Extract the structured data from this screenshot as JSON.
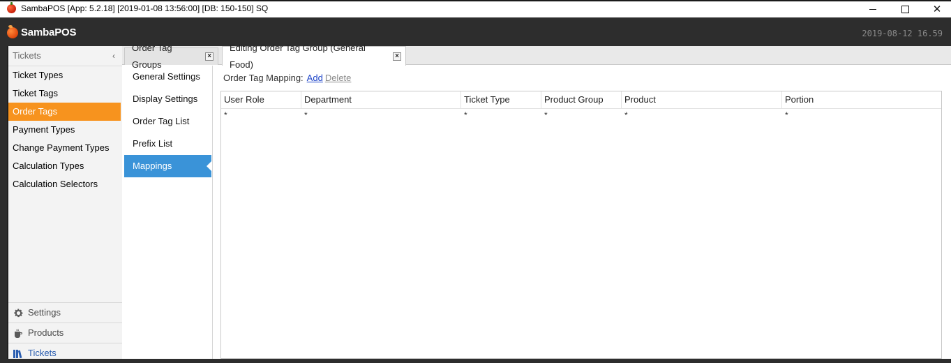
{
  "window": {
    "title": "SambaPOS [App: 5.2.18] [2019-01-08 13:56:00] [DB: 150-150] SQ",
    "close_glyph": "✕"
  },
  "header": {
    "brand": "SambaPOS",
    "clock": "2019-08-12 16.59"
  },
  "leftnav": {
    "section": "Tickets",
    "collapse_glyph": "‹",
    "items": [
      {
        "label": "Ticket Types"
      },
      {
        "label": "Ticket Tags"
      },
      {
        "label": "Order Tags",
        "active": true
      },
      {
        "label": "Payment Types"
      },
      {
        "label": "Change Payment Types"
      },
      {
        "label": "Calculation Types"
      },
      {
        "label": "Calculation Selectors"
      }
    ],
    "bottom": [
      {
        "label": "Settings",
        "icon": "gear-icon"
      },
      {
        "label": "Products",
        "icon": "cup-icon"
      },
      {
        "label": "Tickets",
        "icon": "books-icon"
      }
    ]
  },
  "tabs": [
    {
      "label": "Order Tag Groups",
      "close": "×"
    },
    {
      "label": "Editing Order Tag Group (General Food)",
      "close": "×"
    }
  ],
  "settings_nav": [
    {
      "label": "General Settings"
    },
    {
      "label": "Display Settings"
    },
    {
      "label": "Order Tag List"
    },
    {
      "label": "Prefix List"
    },
    {
      "label": "Mappings",
      "active": true
    }
  ],
  "mapping": {
    "label": "Order Tag Mapping:",
    "add": "Add",
    "delete": "Delete",
    "columns": [
      "User Role",
      "Department",
      "Ticket Type",
      "Product Group",
      "Product",
      "Portion"
    ],
    "rows": [
      [
        "*",
        "*",
        "*",
        "*",
        "*",
        "*"
      ]
    ]
  },
  "colors": {
    "accent_orange": "#f7931e",
    "accent_blue": "#3a93d8",
    "header_dark": "#2d2d2d",
    "link_blue": "#1d44c8"
  }
}
